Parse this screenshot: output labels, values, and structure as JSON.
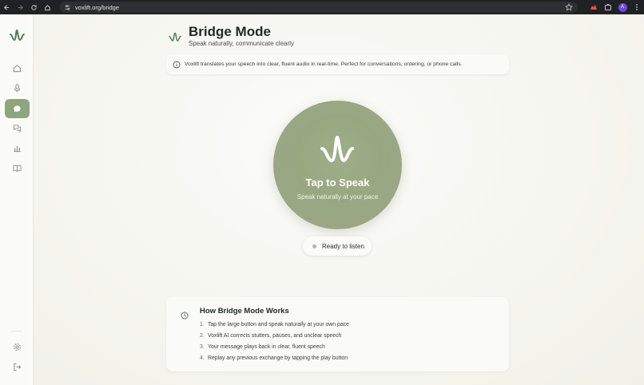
{
  "browser": {
    "url": "voxlift.org/bridge",
    "avatar_initial": "A"
  },
  "sidebar": {
    "items": [
      {
        "icon": "home-icon"
      },
      {
        "icon": "microphone-icon"
      },
      {
        "icon": "chat-bubble-icon",
        "active": true
      },
      {
        "icon": "conversations-icon"
      },
      {
        "icon": "bar-chart-icon"
      },
      {
        "icon": "book-icon"
      }
    ],
    "bottom": [
      {
        "icon": "gear-icon"
      },
      {
        "icon": "logout-icon"
      }
    ]
  },
  "header": {
    "title": "Bridge Mode",
    "subtitle": "Speak naturally, communicate clearly"
  },
  "info": {
    "text": "Voxlift translates your speech into clear, fluent audio in real-time. Perfect for conversations, ordering, or phone calls."
  },
  "speak": {
    "title": "Tap to Speak",
    "subtitle": "Speak naturally at your pace"
  },
  "status": {
    "text": "Ready to listen"
  },
  "how": {
    "title": "How Bridge Mode Works",
    "steps": [
      {
        "num": "1.",
        "text": "Tap the large button and speak naturally at your own pace"
      },
      {
        "num": "2.",
        "text": "Voxlift AI corrects stutters, pauses, and unclear speech"
      },
      {
        "num": "3.",
        "text": "Your message plays back in clear, fluent speech"
      },
      {
        "num": "4.",
        "text": "Replay any previous exchange by tapping the play button"
      }
    ]
  },
  "colors": {
    "accent": "#8fa57d",
    "speak_button": "#9aab84",
    "chrome": "#202124"
  }
}
